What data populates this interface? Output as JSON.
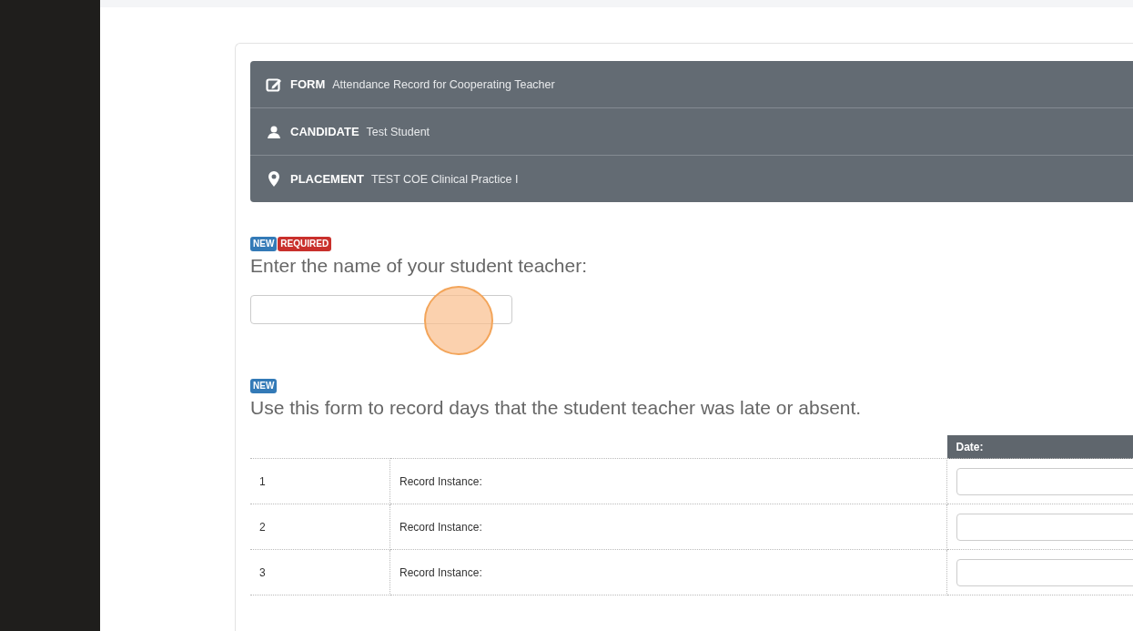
{
  "header": [
    {
      "kind": "form",
      "label": "FORM",
      "value": "Attendance Record for Cooperating Teacher"
    },
    {
      "kind": "candidate",
      "label": "CANDIDATE",
      "value": "Test Student"
    },
    {
      "kind": "placement",
      "label": "PLACEMENT",
      "value": "TEST COE Clinical Practice I"
    }
  ],
  "questions": [
    {
      "badges": [
        {
          "kind": "new",
          "label": "NEW"
        },
        {
          "kind": "required",
          "label": "REQUIRED"
        }
      ],
      "text": "Enter the name of your student teacher:",
      "kind": "text_input"
    },
    {
      "badges": [
        {
          "kind": "new",
          "label": "NEW"
        }
      ],
      "text": "Use this form to record days that the student teacher was late or absent.",
      "kind": "table"
    }
  ],
  "table": {
    "columns": [
      "Date:"
    ],
    "rows": [
      {
        "number": "1",
        "label": "Record Instance:"
      },
      {
        "number": "2",
        "label": "Record Instance:"
      },
      {
        "number": "3",
        "label": "Record Instance:"
      }
    ]
  }
}
